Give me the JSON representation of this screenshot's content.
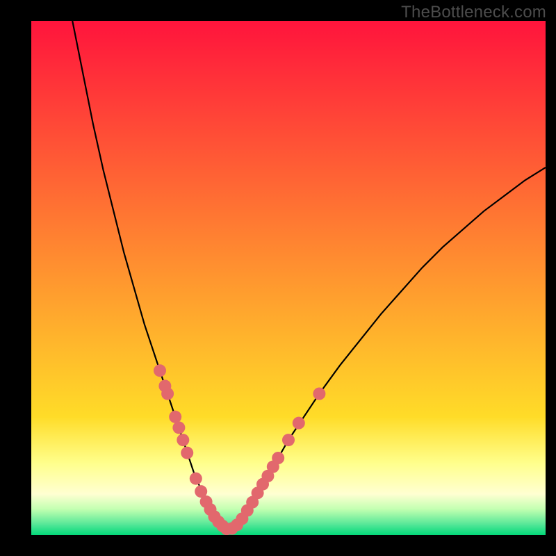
{
  "watermark": "TheBottleneck.com",
  "chart_data": {
    "type": "line",
    "title": "",
    "xlabel": "",
    "ylabel": "",
    "xlim": [
      0,
      100
    ],
    "ylim": [
      0,
      100
    ],
    "series": [
      {
        "name": "left-curve",
        "x": [
          8,
          10,
          12,
          14,
          16,
          18,
          20,
          22,
          24,
          25,
          26,
          27,
          28,
          29,
          30,
          31,
          32,
          33,
          34,
          35,
          36,
          37,
          38
        ],
        "y": [
          100,
          90,
          80,
          71,
          63,
          55,
          48,
          41,
          35,
          32,
          29,
          26,
          23,
          20,
          17,
          14,
          11,
          9,
          7,
          5,
          3.5,
          2.2,
          1.2
        ]
      },
      {
        "name": "right-curve",
        "x": [
          38,
          40,
          42,
          44,
          46,
          48,
          50,
          53,
          56,
          60,
          64,
          68,
          72,
          76,
          80,
          84,
          88,
          92,
          96,
          100
        ],
        "y": [
          1.2,
          2.5,
          5,
          8,
          11.5,
          15,
          18.5,
          23,
          27.5,
          33,
          38,
          43,
          47.5,
          52,
          56,
          59.5,
          63,
          66,
          69,
          71.5
        ]
      }
    ],
    "markers": {
      "name": "highlight-points",
      "color": "#e2686d",
      "points": [
        {
          "x": 25.0,
          "y": 32.0
        },
        {
          "x": 26.0,
          "y": 29.0
        },
        {
          "x": 26.5,
          "y": 27.5
        },
        {
          "x": 28.0,
          "y": 23.0
        },
        {
          "x": 28.7,
          "y": 20.9
        },
        {
          "x": 29.5,
          "y": 18.5
        },
        {
          "x": 30.3,
          "y": 16.0
        },
        {
          "x": 32.0,
          "y": 11.0
        },
        {
          "x": 33.0,
          "y": 8.5
        },
        {
          "x": 34.0,
          "y": 6.5
        },
        {
          "x": 34.8,
          "y": 5.0
        },
        {
          "x": 35.6,
          "y": 3.6
        },
        {
          "x": 36.4,
          "y": 2.6
        },
        {
          "x": 37.2,
          "y": 1.8
        },
        {
          "x": 38.0,
          "y": 1.2
        },
        {
          "x": 39.0,
          "y": 1.3
        },
        {
          "x": 40.0,
          "y": 2.0
        },
        {
          "x": 41.0,
          "y": 3.2
        },
        {
          "x": 42.0,
          "y": 4.8
        },
        {
          "x": 43.0,
          "y": 6.4
        },
        {
          "x": 44.0,
          "y": 8.2
        },
        {
          "x": 45.0,
          "y": 9.9
        },
        {
          "x": 46.0,
          "y": 11.5
        },
        {
          "x": 47.0,
          "y": 13.3
        },
        {
          "x": 48.0,
          "y": 15.0
        },
        {
          "x": 50.0,
          "y": 18.5
        },
        {
          "x": 52.0,
          "y": 21.8
        },
        {
          "x": 56.0,
          "y": 27.5
        }
      ]
    },
    "gradient_bands": [
      {
        "y0": 100,
        "y1": 23,
        "from": "#ff143c",
        "to": "#ffdc28"
      },
      {
        "y0": 23,
        "y1": 14,
        "from": "#ffdc28",
        "to": "#ffff8c"
      },
      {
        "y0": 14,
        "y1": 8,
        "from": "#ffff8c",
        "to": "#ffffd2"
      },
      {
        "y0": 8,
        "y1": 5,
        "from": "#ffffd2",
        "to": "#c0ffb0"
      },
      {
        "y0": 5,
        "y1": 2,
        "from": "#c0ffb0",
        "to": "#50e696"
      },
      {
        "y0": 2,
        "y1": 0,
        "from": "#50e696",
        "to": "#00d878"
      }
    ]
  }
}
